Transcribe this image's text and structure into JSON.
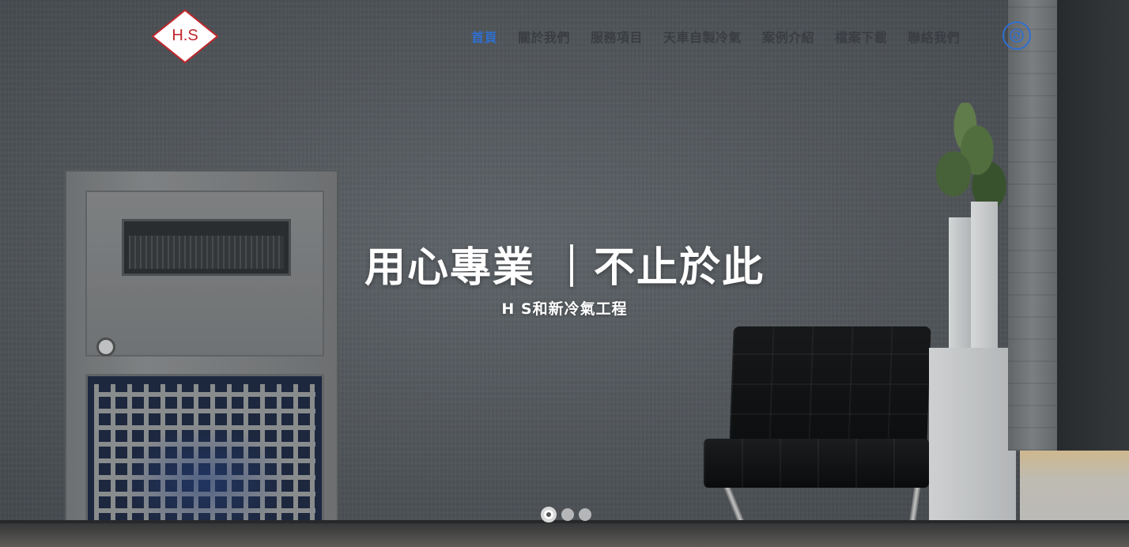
{
  "header": {
    "logo_text": "H.S",
    "nav": [
      {
        "label": "首頁",
        "active": true
      },
      {
        "label": "關於我們",
        "active": false
      },
      {
        "label": "服務項目",
        "active": false
      },
      {
        "label": "天車自製冷氣",
        "active": false
      },
      {
        "label": "案例介紹",
        "active": false
      },
      {
        "label": "檔案下載",
        "active": false
      },
      {
        "label": "聯絡我們",
        "active": false
      }
    ],
    "lang_icon": "language-switch-icon"
  },
  "hero": {
    "title": "用心專業 ｜不止於此",
    "subtitle": "H S和新冷氣工程"
  },
  "slider": {
    "slide_count": 3,
    "active_index": 0
  },
  "colors": {
    "nav_active": "#2f6fd0",
    "nav_text": "#3a3d42",
    "logo_red": "#c0272d"
  }
}
